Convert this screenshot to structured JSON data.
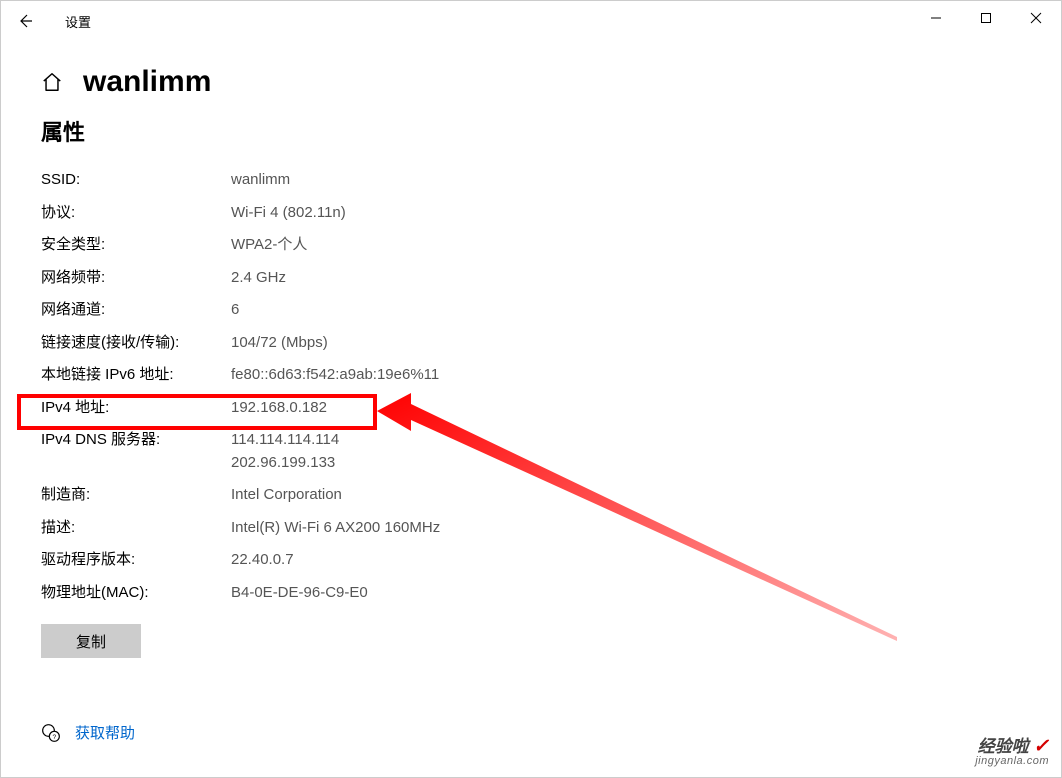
{
  "titlebar": {
    "title": "设置"
  },
  "header": {
    "page_title": "wanlimm"
  },
  "section": {
    "title": "属性"
  },
  "properties": [
    {
      "label": "SSID:",
      "value": "wanlimm"
    },
    {
      "label": "协议:",
      "value": "Wi-Fi 4 (802.11n)"
    },
    {
      "label": "安全类型:",
      "value": "WPA2-个人"
    },
    {
      "label": "网络频带:",
      "value": "2.4 GHz"
    },
    {
      "label": "网络通道:",
      "value": "6"
    },
    {
      "label": "链接速度(接收/传输):",
      "value": "104/72 (Mbps)"
    },
    {
      "label": "本地链接 IPv6 地址:",
      "value": "fe80::6d63:f542:a9ab:19e6%11"
    },
    {
      "label": "IPv4 地址:",
      "value": "192.168.0.182"
    },
    {
      "label": "IPv4 DNS 服务器:",
      "value": "114.114.114.114\n202.96.199.133"
    },
    {
      "label": "制造商:",
      "value": "Intel Corporation"
    },
    {
      "label": "描述:",
      "value": "Intel(R) Wi-Fi 6 AX200 160MHz"
    },
    {
      "label": "驱动程序版本:",
      "value": "22.40.0.7"
    },
    {
      "label": "物理地址(MAC):",
      "value": "B4-0E-DE-96-C9-E0"
    }
  ],
  "buttons": {
    "copy": "复制"
  },
  "help": {
    "link": "获取帮助"
  },
  "watermark": {
    "top": "经验啦",
    "bottom": "jingyanla.com"
  }
}
